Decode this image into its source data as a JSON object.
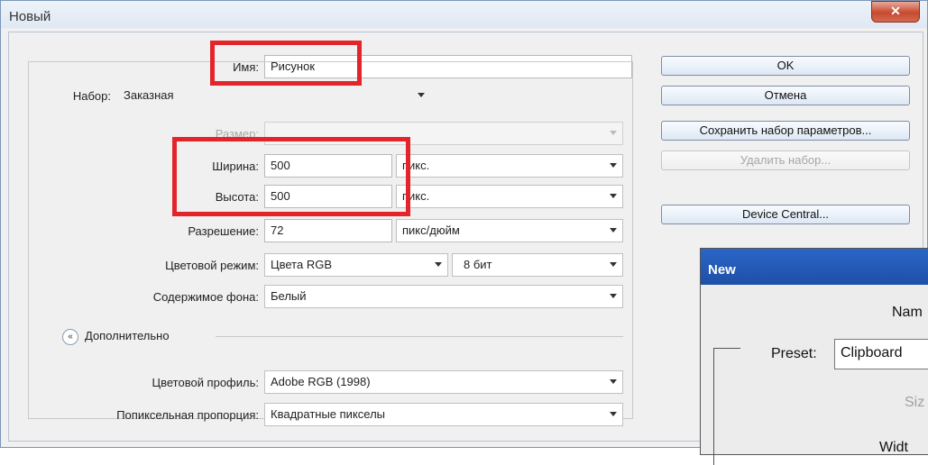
{
  "window": {
    "title": "Новый",
    "close_glyph": "✕"
  },
  "form": {
    "name_label": "Имя:",
    "name_value": "Рисунок",
    "preset_label": "Набор:",
    "preset_value": "Заказная",
    "size_label": "Размер:",
    "width_label": "Ширина:",
    "width_value": "500",
    "width_unit": "пикс.",
    "height_label": "Высота:",
    "height_value": "500",
    "height_unit": "пикс.",
    "resolution_label": "Разрешение:",
    "resolution_value": "72",
    "resolution_unit": "пикс/дюйм",
    "color_mode_label": "Цветовой режим:",
    "color_mode_value": "Цвета RGB",
    "bit_depth_value": "8 бит",
    "background_label": "Содержимое фона:",
    "background_value": "Белый",
    "advanced_label": "Дополнительно",
    "advanced_icon_glyph": "«",
    "color_profile_label": "Цветовой профиль:",
    "color_profile_value": "Adobe RGB (1998)",
    "pixel_aspect_label": "Попиксельная пропорция:",
    "pixel_aspect_value": "Квадратные пикселы"
  },
  "buttons": {
    "ok": "OK",
    "cancel": "Отмена",
    "save_preset": "Сохранить набор параметров...",
    "delete_preset": "Удалить набор...",
    "device_central": "Device Central..."
  },
  "overlay": {
    "title": "New",
    "name_label": "Nam",
    "preset_label": "Preset:",
    "preset_value": "Clipboard",
    "size_label": "Siz",
    "width_label": "Widt"
  },
  "colors": {
    "highlight": "#e3242b",
    "title_blue": "#1d4fa8"
  }
}
